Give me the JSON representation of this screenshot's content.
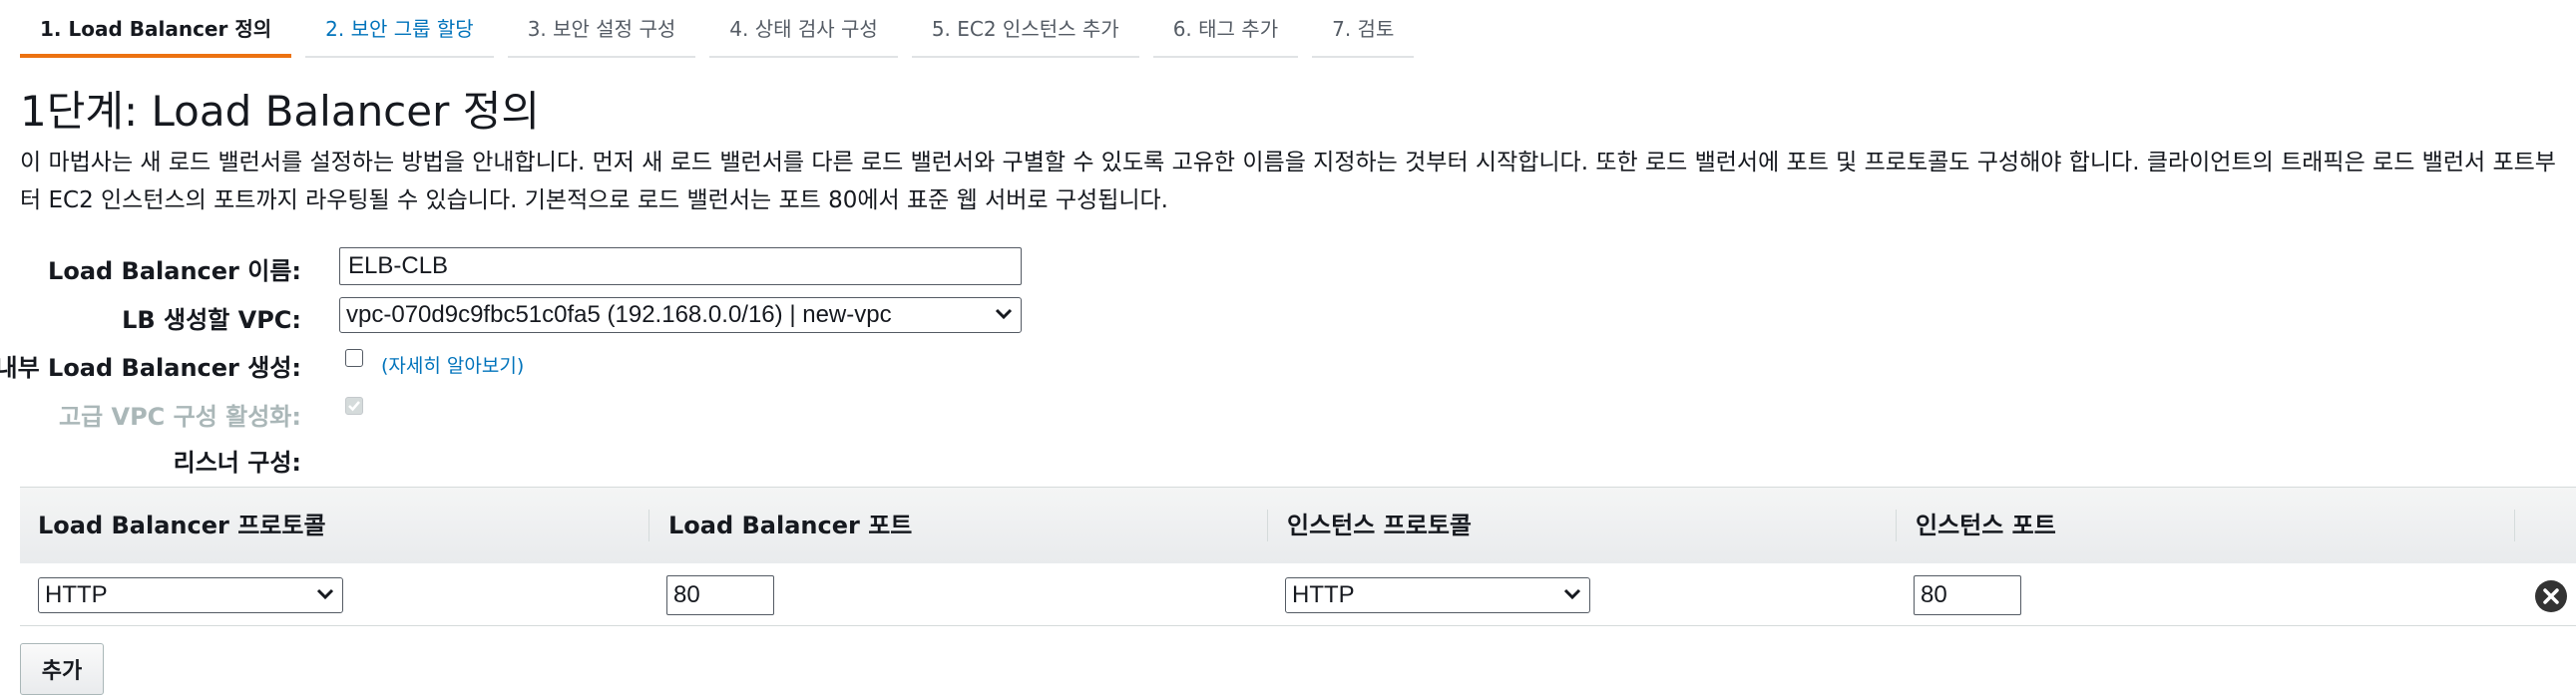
{
  "wizard": {
    "steps": [
      "1. Load Balancer 정의",
      "2. 보안 그룹 할당",
      "3. 보안 설정 구성",
      "4. 상태 검사 구성",
      "5. EC2 인스턴스 추가",
      "6. 태그 추가",
      "7. 검토"
    ],
    "active_step": 0
  },
  "page": {
    "title": "1단계: Load Balancer 정의",
    "description": "이 마법사는 새 로드 밸런서를 설정하는 방법을 안내합니다. 먼저 새 로드 밸런서를 다른 로드 밸런서와 구별할 수 있도록 고유한 이름을 지정하는 것부터 시작합니다. 또한 로드 밸런서에 포트 및 프로토콜도 구성해야 합니다. 클라이언트의 트래픽은 로드 밸런서 포트부터 EC2 인스턴스의 포트까지 라우팅될 수 있습니다. 기본적으로 로드 밸런서는 포트 80에서 표준 웹 서버로 구성됩니다."
  },
  "form": {
    "name_label": "Load Balancer 이름:",
    "name_value": "ELB-CLB",
    "vpc_label": "LB 생성할 VPC:",
    "vpc_value": "vpc-070d9c9fbc51c0fa5 (192.168.0.0/16) | new-vpc",
    "internal_label": "내부 Load Balancer 생성:",
    "internal_checked": false,
    "learn_more": "(자세히 알아보기)",
    "advanced_label": "고급 VPC 구성 활성화:",
    "advanced_checked": true,
    "advanced_disabled": true,
    "listener_label": "리스너 구성:"
  },
  "listeners": {
    "headers": [
      "Load Balancer 프로토콜",
      "Load Balancer 포트",
      "인스턴스 프로토콜",
      "인스턴스 포트"
    ],
    "rows": [
      {
        "lb_protocol": "HTTP",
        "lb_port": "80",
        "instance_protocol": "HTTP",
        "instance_port": "80"
      }
    ],
    "add_button": "추가"
  },
  "icons": {
    "select_arrow": "chevron-down-icon",
    "remove": "close-circle-icon"
  },
  "colors": {
    "active_tab_underline": "#ec7211",
    "link": "#0073bb"
  }
}
